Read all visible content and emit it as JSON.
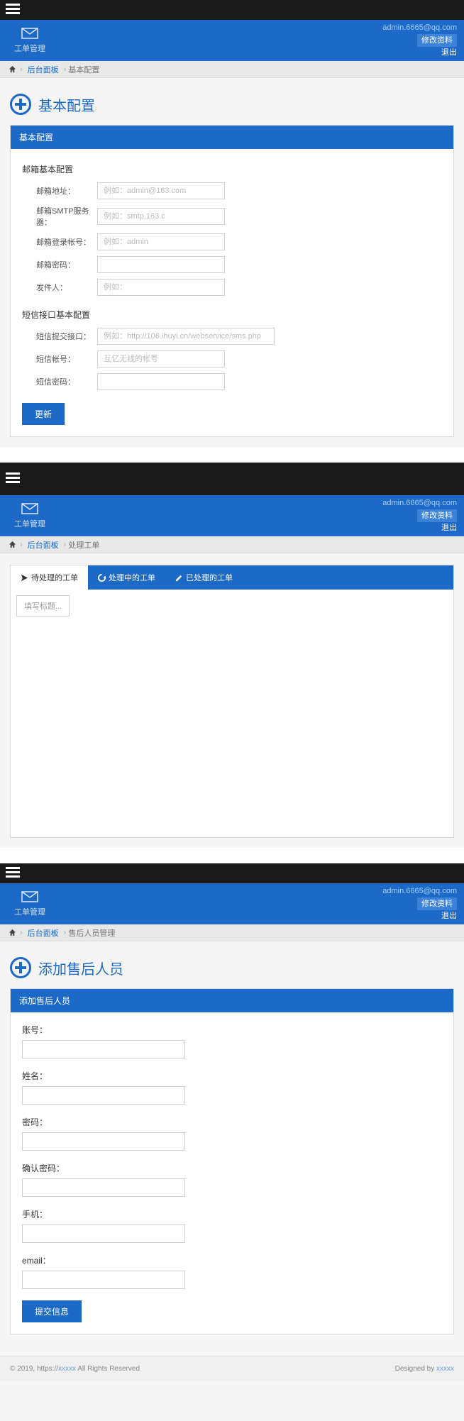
{
  "header": {
    "brand": "工单管理",
    "user_email": "admin.6665@qq.com",
    "link_profile": "修改资料",
    "link_logout": "退出"
  },
  "s1": {
    "bc": {
      "dash": "后台面板",
      "cur": "基本配置"
    },
    "page_title": "基本配置",
    "panel_title": "基本配置",
    "sec_mail": "邮箱基本配置",
    "mail": {
      "addr_lbl": "邮箱地址：",
      "addr_ph": "例如：admin@163.com",
      "smtp_lbl": "邮箱SMTP服务器：",
      "smtp_ph": "例如：smtp.163.c",
      "login_lbl": "邮箱登录帐号：",
      "login_ph": "例如：admin",
      "pwd_lbl": "邮箱密码：",
      "sender_lbl": "发件人：",
      "sender_ph": "例如："
    },
    "sec_sms": "短信接口基本配置",
    "sms": {
      "api_lbl": "短信提交接口：",
      "api_ph": "例如：http://106.ihuyi.cn/webservice/sms.php",
      "acct_lbl": "短信帐号：",
      "acct_ph": "互亿无线的帐号",
      "pwd_lbl": "短信密码："
    },
    "btn": "更新"
  },
  "s2": {
    "bc": {
      "dash": "后台面板",
      "cur": "处理工单"
    },
    "tabs": {
      "t1": "待处理的工单",
      "t2": "处理中的工单",
      "t3": "已处理的工单"
    },
    "filter_ph": "填写标题..."
  },
  "s3": {
    "bc": {
      "dash": "后台面板",
      "cur": "售后人员管理"
    },
    "page_title": "添加售后人员",
    "panel_title": "添加售后人员",
    "f": {
      "acct": "账号：",
      "name": "姓名：",
      "pwd": "密码：",
      "cpwd": "确认密码：",
      "phone": "手机：",
      "email": "email："
    },
    "btn": "提交信息"
  },
  "footer": {
    "copy_pre": "© 2019, https://",
    "copy_link": "xxxxx",
    "copy_post": " All Rights Reserved",
    "des_pre": "Designed by ",
    "des_link": "xxxxx"
  }
}
